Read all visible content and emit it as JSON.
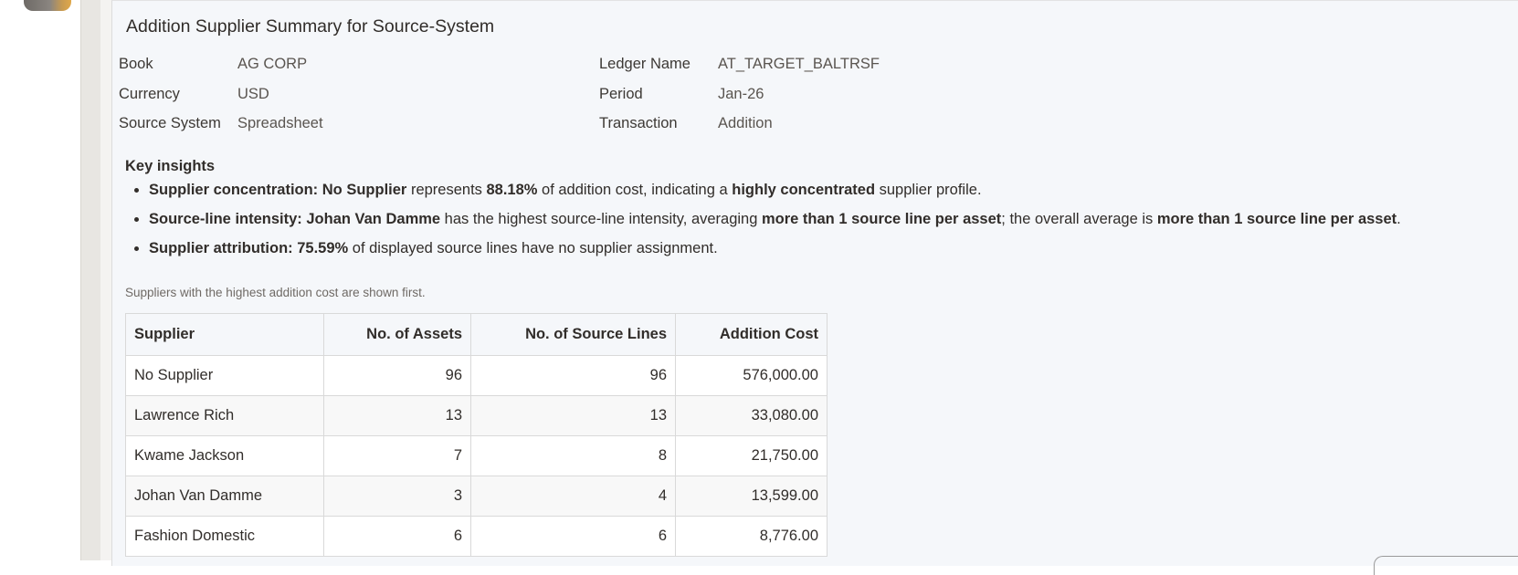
{
  "panel": {
    "title": "Addition Supplier Summary for Source-System"
  },
  "meta": {
    "book_label": "Book",
    "book_value": "AG CORP",
    "currency_label": "Currency",
    "currency_value": "USD",
    "source_system_label": "Source System",
    "source_system_value": "Spreadsheet",
    "ledger_label": "Ledger Name",
    "ledger_value": "AT_TARGET_BALTRSF",
    "period_label": "Period",
    "period_value": "Jan-26",
    "transaction_label": "Transaction",
    "transaction_value": "Addition"
  },
  "insights": {
    "heading": "Key insights",
    "items": [
      {
        "lead": "Supplier concentration: No Supplier",
        "t1": " represents ",
        "b1": "88.18%",
        "t2": " of addition cost, indicating a ",
        "b2": "highly concentrated",
        "t3": " supplier profile."
      },
      {
        "lead": "Source-line intensity: Johan Van Damme",
        "t1": " has the highest source-line intensity, averaging ",
        "b1": "more than 1 source line per asset",
        "t2": "; the overall average is ",
        "b2": "more than 1 source line per asset",
        "t3": "."
      },
      {
        "lead": "Supplier attribution: 75.59%",
        "t1": " of displayed source lines have no supplier assignment."
      }
    ]
  },
  "table": {
    "note": "Suppliers with the highest addition cost are shown first.",
    "columns": [
      "Supplier",
      "No. of Assets",
      "No. of Source Lines",
      "Addition Cost"
    ],
    "rows": [
      [
        "No Supplier",
        "96",
        "96",
        "576,000.00"
      ],
      [
        "Lawrence Rich",
        "13",
        "13",
        "33,080.00"
      ],
      [
        "Kwame Jackson",
        "7",
        "8",
        "21,750.00"
      ],
      [
        "Johan Van Damme",
        "3",
        "4",
        "13,599.00"
      ],
      [
        "Fashion Domestic",
        "6",
        "6",
        "8,776.00"
      ]
    ]
  }
}
